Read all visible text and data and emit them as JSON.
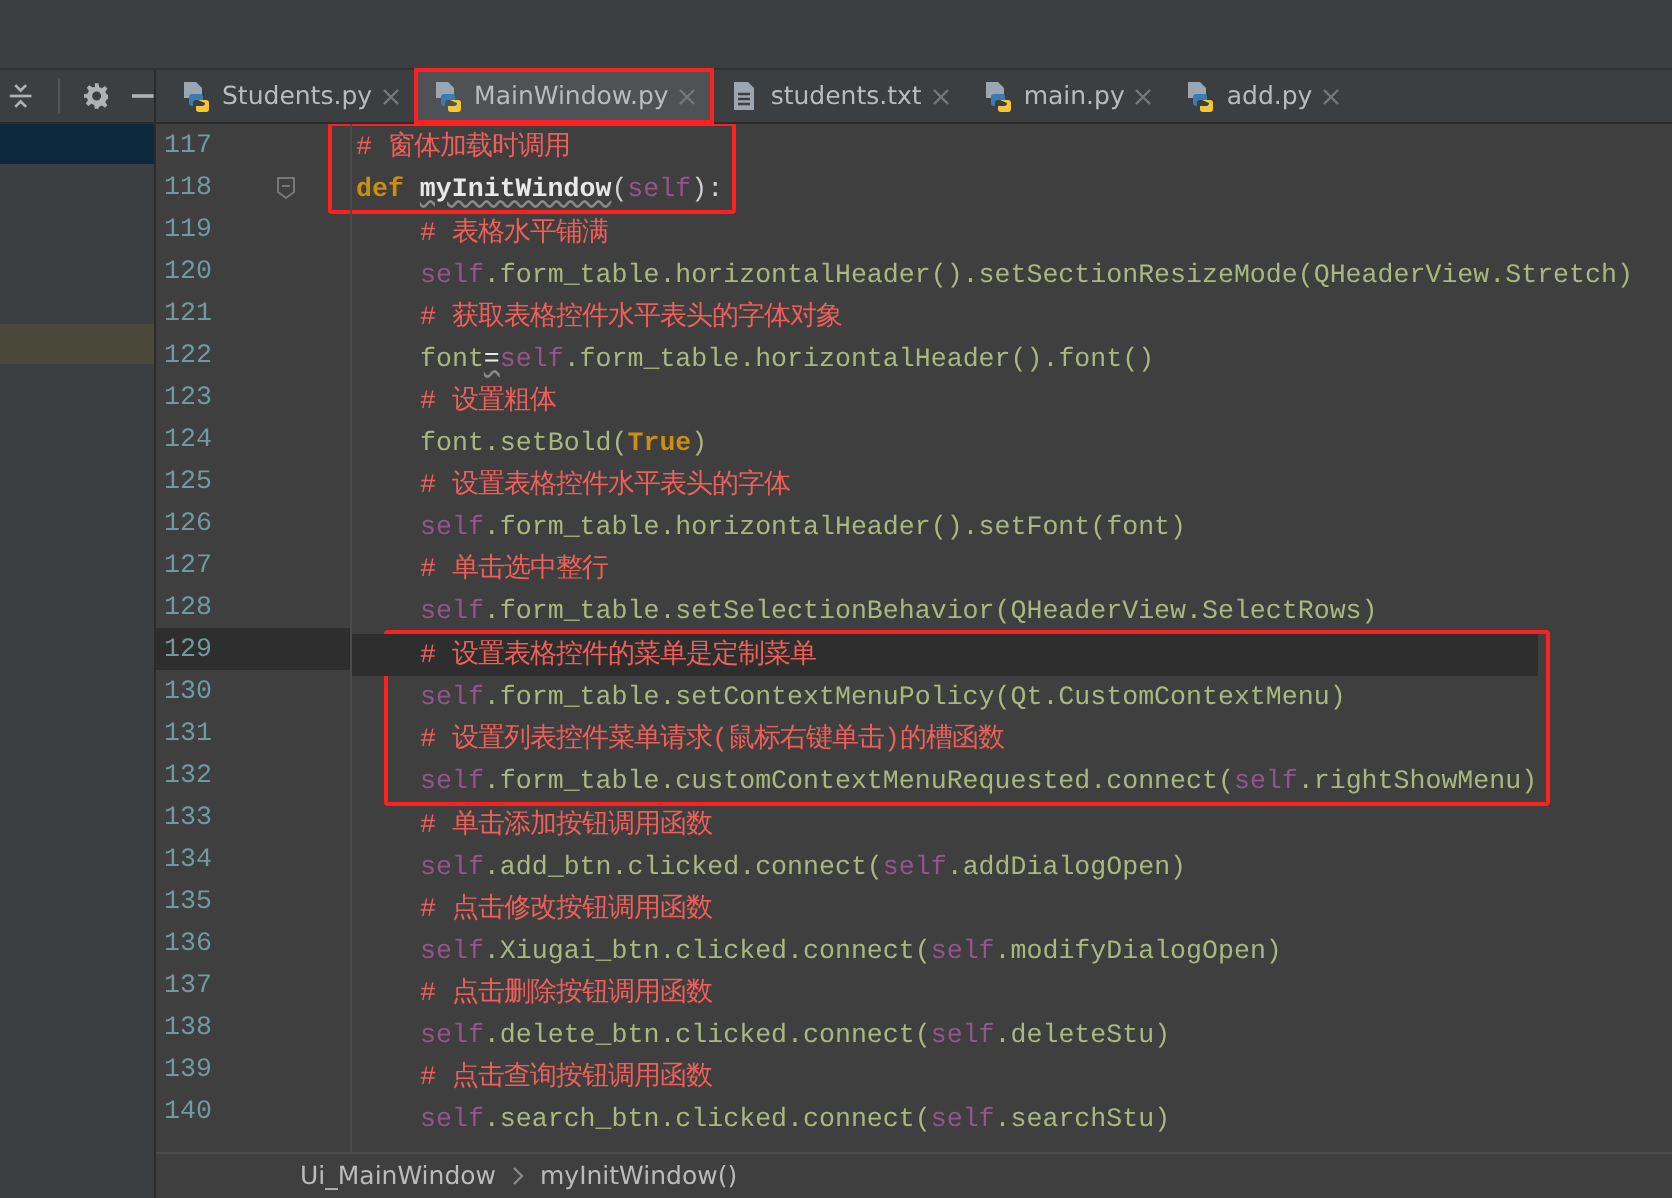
{
  "sidebar": {
    "rows": [
      {
        "selected": true
      },
      {
        "selected": false
      }
    ]
  },
  "tabs": [
    {
      "label": "Students.py",
      "kind": "python",
      "selected": false,
      "boxed": false
    },
    {
      "label": "MainWindow.py",
      "kind": "python",
      "selected": true,
      "boxed": true
    },
    {
      "label": "students.txt",
      "kind": "text",
      "selected": false,
      "boxed": false
    },
    {
      "label": "main.py",
      "kind": "python",
      "selected": false,
      "boxed": false
    },
    {
      "label": "add.py",
      "kind": "python",
      "selected": false,
      "boxed": false
    }
  ],
  "code_lines": [
    {
      "number": "117",
      "nested": false,
      "fold": false,
      "current": false,
      "boxed": true,
      "segments": [
        {
          "kind": "comment",
          "text": "# 窗体加载时调用"
        }
      ]
    },
    {
      "number": "118",
      "nested": false,
      "fold": true,
      "current": false,
      "boxed": true,
      "segments": [
        {
          "kind": "keyword",
          "text": "def "
        },
        {
          "kind": "funcname",
          "text": "myInitWindow"
        },
        {
          "kind": "punct",
          "text": "("
        },
        {
          "kind": "self",
          "text": "self"
        },
        {
          "kind": "punct",
          "text": "):"
        }
      ]
    },
    {
      "number": "119",
      "nested": true,
      "fold": false,
      "current": false,
      "boxed": false,
      "segments": [
        {
          "kind": "comment",
          "text": "# 表格水平铺满"
        }
      ]
    },
    {
      "number": "120",
      "nested": true,
      "fold": false,
      "current": false,
      "boxed": false,
      "segments": [
        {
          "kind": "self",
          "text": "self"
        },
        {
          "kind": "plain",
          "text": ".form_table.horizontalHeader().setSectionResizeMode(QHeaderView.Stretch)"
        }
      ]
    },
    {
      "number": "121",
      "nested": true,
      "fold": false,
      "current": false,
      "boxed": false,
      "segments": [
        {
          "kind": "comment",
          "text": "# 获取表格控件水平表头的字体对象"
        }
      ]
    },
    {
      "number": "122",
      "nested": true,
      "fold": false,
      "current": false,
      "boxed": false,
      "segments": [
        {
          "kind": "plain",
          "text": "font"
        },
        {
          "kind": "warning",
          "text": "="
        },
        {
          "kind": "self",
          "text": "self"
        },
        {
          "kind": "plain",
          "text": ".form_table.horizontalHeader().font()"
        }
      ]
    },
    {
      "number": "123",
      "nested": true,
      "fold": false,
      "current": false,
      "boxed": false,
      "segments": [
        {
          "kind": "comment",
          "text": "# 设置粗体"
        }
      ]
    },
    {
      "number": "124",
      "nested": true,
      "fold": false,
      "current": false,
      "boxed": false,
      "segments": [
        {
          "kind": "plain",
          "text": "font.setBold("
        },
        {
          "kind": "keyword",
          "text": "True"
        },
        {
          "kind": "plain",
          "text": ")"
        }
      ]
    },
    {
      "number": "125",
      "nested": true,
      "fold": false,
      "current": false,
      "boxed": false,
      "segments": [
        {
          "kind": "comment",
          "text": "# 设置表格控件水平表头的字体"
        }
      ]
    },
    {
      "number": "126",
      "nested": true,
      "fold": false,
      "current": false,
      "boxed": false,
      "segments": [
        {
          "kind": "self",
          "text": "self"
        },
        {
          "kind": "plain",
          "text": ".form_table.horizontalHeader().setFont(font)"
        }
      ]
    },
    {
      "number": "127",
      "nested": true,
      "fold": false,
      "current": false,
      "boxed": false,
      "segments": [
        {
          "kind": "comment",
          "text": "# 单击选中整行"
        }
      ]
    },
    {
      "number": "128",
      "nested": true,
      "fold": false,
      "current": false,
      "boxed": false,
      "segments": [
        {
          "kind": "self",
          "text": "self"
        },
        {
          "kind": "plain",
          "text": ".form_table.setSelectionBehavior(QHeaderView.SelectRows)"
        }
      ]
    },
    {
      "number": "129",
      "nested": true,
      "fold": false,
      "current": true,
      "boxed": true,
      "segments": [
        {
          "kind": "comment",
          "text": "# 设置表格控件的菜单是定制菜单"
        }
      ]
    },
    {
      "number": "130",
      "nested": true,
      "fold": false,
      "current": false,
      "boxed": true,
      "segments": [
        {
          "kind": "self",
          "text": "self"
        },
        {
          "kind": "plain",
          "text": ".form_table.setContextMenuPolicy(Qt.CustomContextMenu)"
        }
      ]
    },
    {
      "number": "131",
      "nested": true,
      "fold": false,
      "current": false,
      "boxed": true,
      "segments": [
        {
          "kind": "comment",
          "text": "# 设置列表控件菜单请求(鼠标右键单击)的槽函数"
        }
      ]
    },
    {
      "number": "132",
      "nested": true,
      "fold": false,
      "current": false,
      "boxed": true,
      "segments": [
        {
          "kind": "self",
          "text": "self"
        },
        {
          "kind": "plain",
          "text": ".form_table.customContextMenuRequested.connect("
        },
        {
          "kind": "self",
          "text": "self"
        },
        {
          "kind": "plain",
          "text": ".rightShowMenu)"
        }
      ]
    },
    {
      "number": "133",
      "nested": true,
      "fold": false,
      "current": false,
      "boxed": false,
      "segments": [
        {
          "kind": "comment",
          "text": "# 单击添加按钮调用函数"
        }
      ]
    },
    {
      "number": "134",
      "nested": true,
      "fold": false,
      "current": false,
      "boxed": false,
      "segments": [
        {
          "kind": "self",
          "text": "self"
        },
        {
          "kind": "plain",
          "text": ".add_btn.clicked.connect("
        },
        {
          "kind": "self",
          "text": "self"
        },
        {
          "kind": "plain",
          "text": ".addDialogOpen)"
        }
      ]
    },
    {
      "number": "135",
      "nested": true,
      "fold": false,
      "current": false,
      "boxed": false,
      "segments": [
        {
          "kind": "comment",
          "text": "# 点击修改按钮调用函数"
        }
      ]
    },
    {
      "number": "136",
      "nested": true,
      "fold": false,
      "current": false,
      "boxed": false,
      "segments": [
        {
          "kind": "self",
          "text": "self"
        },
        {
          "kind": "plain",
          "text": ".Xiugai_btn.clicked.connect("
        },
        {
          "kind": "self",
          "text": "self"
        },
        {
          "kind": "plain",
          "text": ".modifyDialogOpen)"
        }
      ]
    },
    {
      "number": "137",
      "nested": true,
      "fold": false,
      "current": false,
      "boxed": false,
      "segments": [
        {
          "kind": "comment",
          "text": "# 点击删除按钮调用函数"
        }
      ]
    },
    {
      "number": "138",
      "nested": true,
      "fold": false,
      "current": false,
      "boxed": false,
      "segments": [
        {
          "kind": "self",
          "text": "self"
        },
        {
          "kind": "plain",
          "text": ".delete_btn.clicked.connect("
        },
        {
          "kind": "self",
          "text": "self"
        },
        {
          "kind": "plain",
          "text": ".deleteStu)"
        }
      ]
    },
    {
      "number": "139",
      "nested": true,
      "fold": false,
      "current": false,
      "boxed": false,
      "segments": [
        {
          "kind": "comment",
          "text": "# 点击查询按钮调用函数"
        }
      ]
    },
    {
      "number": "140",
      "nested": true,
      "fold": false,
      "current": false,
      "boxed": false,
      "segments": [
        {
          "kind": "self",
          "text": "self"
        },
        {
          "kind": "plain",
          "text": ".search_btn.clicked.connect("
        },
        {
          "kind": "self",
          "text": "self"
        },
        {
          "kind": "plain",
          "text": ".searchStu)"
        }
      ]
    }
  ],
  "breadcrumb": [
    "Ui_MainWindow",
    "myInitWindow()"
  ]
}
